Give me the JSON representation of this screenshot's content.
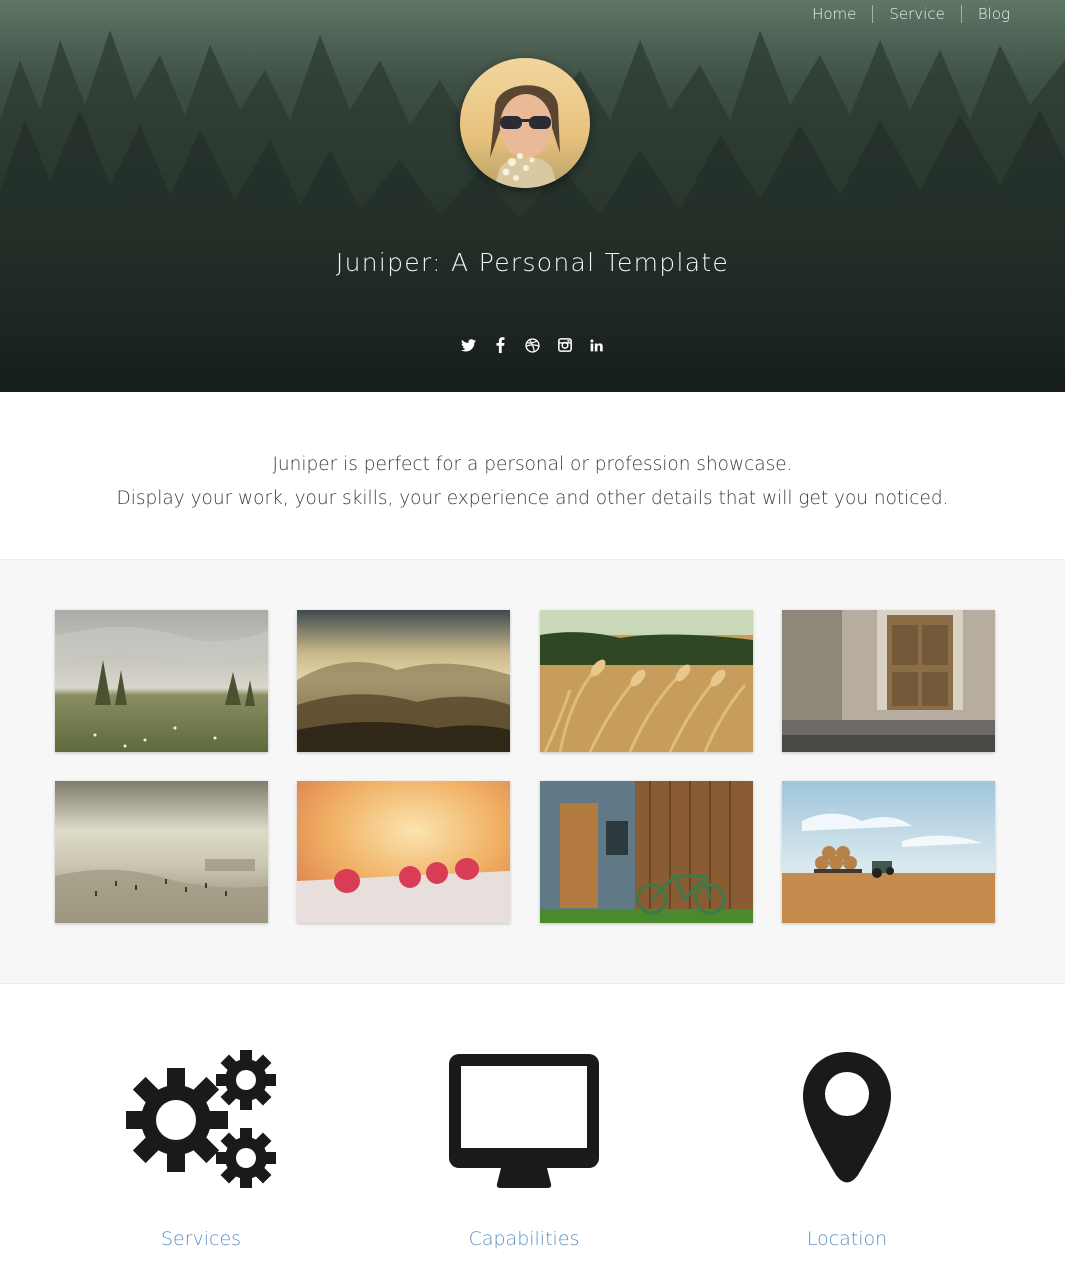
{
  "nav": {
    "items": [
      {
        "label": "Home"
      },
      {
        "label": "Service"
      },
      {
        "label": "Blog"
      }
    ]
  },
  "hero": {
    "title": "Juniper: A Personal Template",
    "social": [
      "twitter-icon",
      "facebook-icon",
      "dribbble-icon",
      "instagram-icon",
      "linkedin-icon"
    ]
  },
  "intro": {
    "line1": "Juniper is perfect for a personal or profession showcase.",
    "line2": "Display your work, your skills, your experience and other details that will get you noticed."
  },
  "gallery": {
    "images": [
      "moorland-trees",
      "misty-hills-sunset",
      "wheat-field",
      "old-wooden-door",
      "hazy-beach",
      "raspberries-on-ledge",
      "wooden-shed-with-bicycle",
      "hay-bales-tractor-field"
    ]
  },
  "features": [
    {
      "label": "Services",
      "icon": "gears-icon"
    },
    {
      "label": "Capabilities",
      "icon": "desktop-icon"
    },
    {
      "label": "Location",
      "icon": "map-pin-icon"
    }
  ],
  "colors": {
    "accent": "#5e8fc4",
    "hero_dark": "#1e2722",
    "gallery_bg": "#f7f7f7",
    "icon_dark": "#1a1a1a"
  }
}
